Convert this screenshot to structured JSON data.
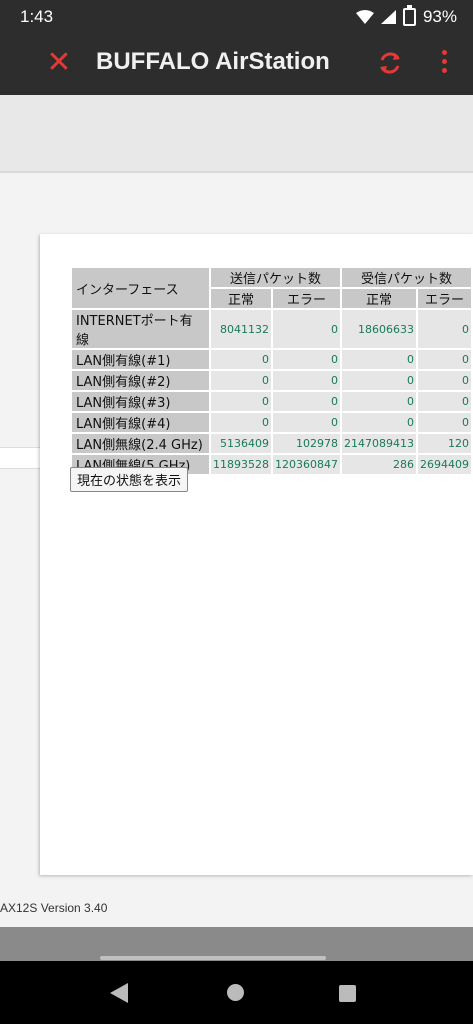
{
  "status_bar": {
    "time": "1:43",
    "battery": "93%"
  },
  "app_bar": {
    "title": "BUFFALO AirStation",
    "accent": "#e53935"
  },
  "table": {
    "interface_header": "インターフェース",
    "tx_header": "送信パケット数",
    "rx_header": "受信パケット数",
    "normal": "正常",
    "error": "エラー",
    "rows": [
      {
        "name": "INTERNETポート有線",
        "tx_ok": "8041132",
        "tx_err": "0",
        "rx_ok": "18606633",
        "rx_err": "0"
      },
      {
        "name": "LAN側有線(#1)",
        "tx_ok": "0",
        "tx_err": "0",
        "rx_ok": "0",
        "rx_err": "0"
      },
      {
        "name": "LAN側有線(#2)",
        "tx_ok": "0",
        "tx_err": "0",
        "rx_ok": "0",
        "rx_err": "0"
      },
      {
        "name": "LAN側有線(#3)",
        "tx_ok": "0",
        "tx_err": "0",
        "rx_ok": "0",
        "rx_err": "0"
      },
      {
        "name": "LAN側有線(#4)",
        "tx_ok": "0",
        "tx_err": "0",
        "rx_ok": "0",
        "rx_err": "0"
      },
      {
        "name": "LAN側無線(2.4 GHz)",
        "tx_ok": "5136409",
        "tx_err": "102978",
        "rx_ok": "2147089413",
        "rx_err": "120"
      },
      {
        "name": "LAN側無線(5 GHz)",
        "tx_ok": "11893528",
        "tx_err": "120360847",
        "rx_ok": "286",
        "rx_err": "2694409"
      }
    ]
  },
  "show_status_button": "現在の状態を表示",
  "footer": "AX12S   Version 3.40"
}
